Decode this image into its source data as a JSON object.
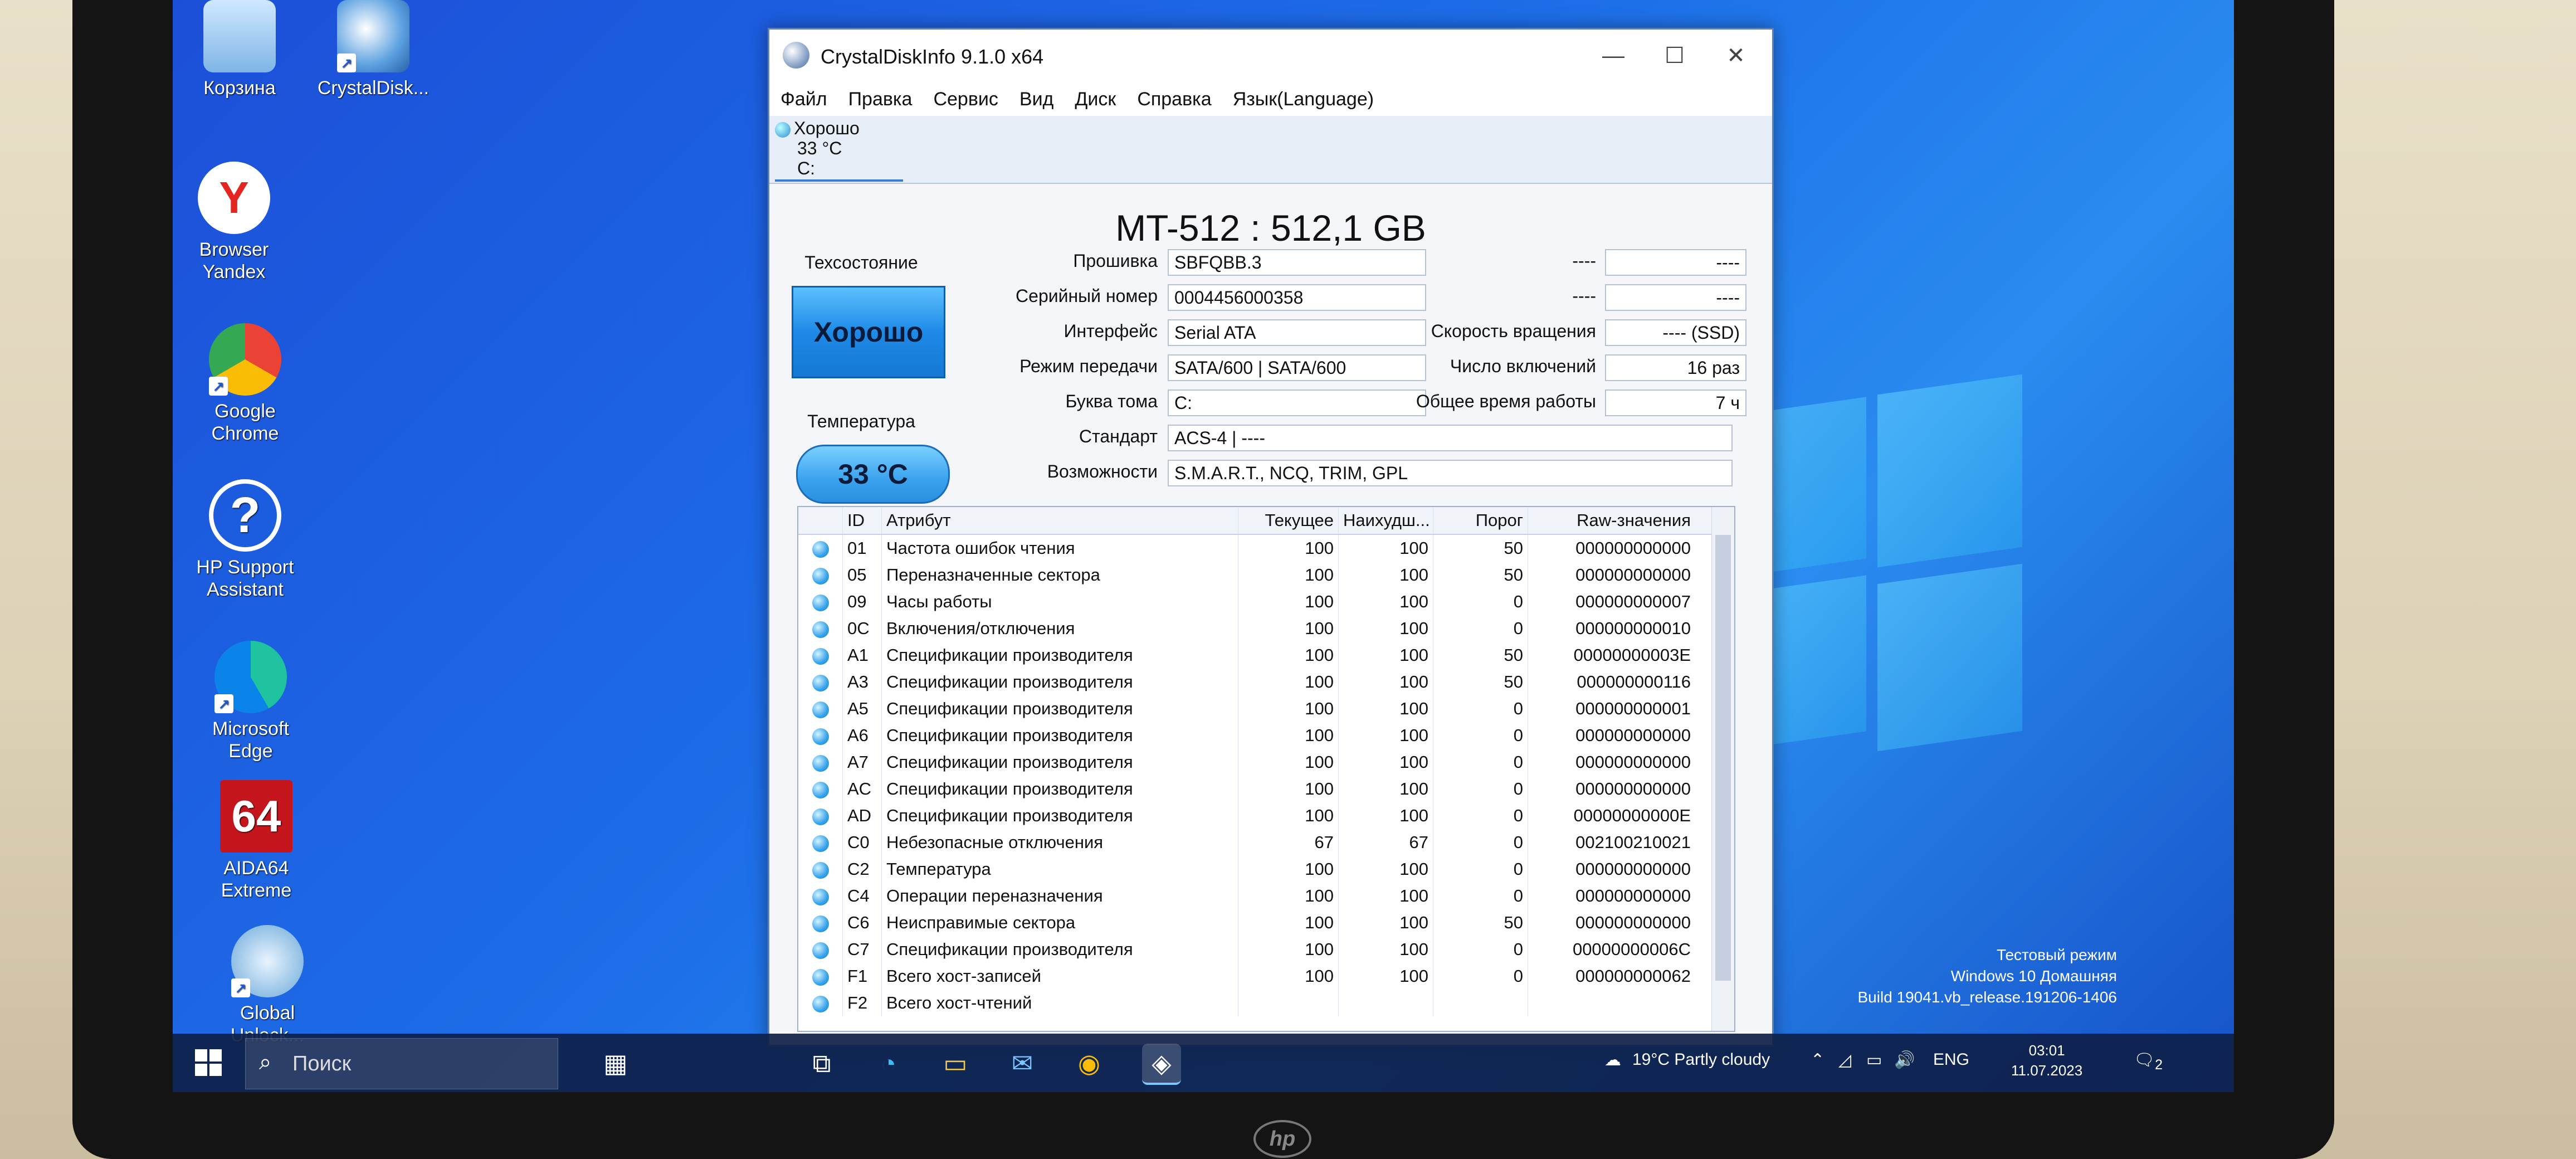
{
  "desktop": {
    "icons": [
      {
        "label": "Корзина",
        "icon": "recycle-bin-icon"
      },
      {
        "label": "CrystalDisk...",
        "icon": "crystaldisk-icon"
      },
      {
        "label": "Browser Yandex",
        "icon": "yandex-browser-icon"
      },
      {
        "label": "Google Chrome",
        "icon": "chrome-icon"
      },
      {
        "label": "HP Support Assistant",
        "icon": "help-icon"
      },
      {
        "label": "Microsoft Edge",
        "icon": "edge-icon"
      },
      {
        "label": "AIDA64 Extreme",
        "icon": "aida64-icon"
      },
      {
        "label": "Global Unlock...",
        "icon": "unlock-icon"
      }
    ]
  },
  "window": {
    "title": "CrystalDiskInfo 9.1.0 x64",
    "menu": [
      "Файл",
      "Правка",
      "Сервис",
      "Вид",
      "Диск",
      "Справка",
      "Язык(Language)"
    ],
    "drive_tab": {
      "status": "Хорошо",
      "temp": "33 °C",
      "letter": "C:"
    },
    "model": "MT-512 : 512,1 GB",
    "health_label": "Техсостояние",
    "health_value": "Хорошо",
    "temp_label": "Температура",
    "temp_value": "33 °C",
    "info": {
      "firmware": {
        "label": "Прошивка",
        "value": "SBFQBB.3"
      },
      "serial": {
        "label": "Серийный номер",
        "value": "0004456000358"
      },
      "interface": {
        "label": "Интерфейс",
        "value": "Serial ATA"
      },
      "transfer": {
        "label": "Режим передачи",
        "value": "SATA/600 | SATA/600"
      },
      "volume": {
        "label": "Буква тома",
        "value": "C:"
      },
      "standard": {
        "label": "Стандарт",
        "value": "ACS-4 | ----"
      },
      "features": {
        "label": "Возможности",
        "value": "S.M.A.R.T., NCQ, TRIM, GPL"
      }
    },
    "right_info": {
      "row1": {
        "label": "----",
        "value": "----"
      },
      "row2": {
        "label": "----",
        "value": "----"
      },
      "rotation": {
        "label": "Скорость вращения",
        "value": "---- (SSD)"
      },
      "power_count": {
        "label": "Число включений",
        "value": "16 раз"
      },
      "power_hours": {
        "label": "Общее время работы",
        "value": "7 ч"
      }
    },
    "smart_headers": {
      "id": "ID",
      "attr": "Атрибут",
      "current": "Текущее",
      "worst": "Наихудш...",
      "threshold": "Порог",
      "raw": "Raw-значения"
    },
    "smart_rows": [
      {
        "id": "01",
        "attr": "Частота ошибок чтения",
        "current": "100",
        "worst": "100",
        "threshold": "50",
        "raw": "000000000000"
      },
      {
        "id": "05",
        "attr": "Переназначенные сектора",
        "current": "100",
        "worst": "100",
        "threshold": "50",
        "raw": "000000000000"
      },
      {
        "id": "09",
        "attr": "Часы работы",
        "current": "100",
        "worst": "100",
        "threshold": "0",
        "raw": "000000000007"
      },
      {
        "id": "0C",
        "attr": "Включения/отключения",
        "current": "100",
        "worst": "100",
        "threshold": "0",
        "raw": "000000000010"
      },
      {
        "id": "A1",
        "attr": "Спецификации производителя",
        "current": "100",
        "worst": "100",
        "threshold": "50",
        "raw": "00000000003E"
      },
      {
        "id": "A3",
        "attr": "Спецификации производителя",
        "current": "100",
        "worst": "100",
        "threshold": "50",
        "raw": "000000000116"
      },
      {
        "id": "A5",
        "attr": "Спецификации производителя",
        "current": "100",
        "worst": "100",
        "threshold": "0",
        "raw": "000000000001"
      },
      {
        "id": "A6",
        "attr": "Спецификации производителя",
        "current": "100",
        "worst": "100",
        "threshold": "0",
        "raw": "000000000000"
      },
      {
        "id": "A7",
        "attr": "Спецификации производителя",
        "current": "100",
        "worst": "100",
        "threshold": "0",
        "raw": "000000000000"
      },
      {
        "id": "AC",
        "attr": "Спецификации производителя",
        "current": "100",
        "worst": "100",
        "threshold": "0",
        "raw": "000000000000"
      },
      {
        "id": "AD",
        "attr": "Спецификации производителя",
        "current": "100",
        "worst": "100",
        "threshold": "0",
        "raw": "00000000000E"
      },
      {
        "id": "C0",
        "attr": "Небезопасные отключения",
        "current": "67",
        "worst": "67",
        "threshold": "0",
        "raw": "002100210021"
      },
      {
        "id": "C2",
        "attr": "Температура",
        "current": "100",
        "worst": "100",
        "threshold": "0",
        "raw": "000000000000"
      },
      {
        "id": "C4",
        "attr": "Операции переназначения",
        "current": "100",
        "worst": "100",
        "threshold": "0",
        "raw": "000000000000"
      },
      {
        "id": "C6",
        "attr": "Неисправимые сектора",
        "current": "100",
        "worst": "100",
        "threshold": "50",
        "raw": "000000000000"
      },
      {
        "id": "C7",
        "attr": "Спецификации производителя",
        "current": "100",
        "worst": "100",
        "threshold": "0",
        "raw": "00000000006C"
      },
      {
        "id": "F1",
        "attr": "Всего хост-записей",
        "current": "100",
        "worst": "100",
        "threshold": "0",
        "raw": "000000000062"
      },
      {
        "id": "F2",
        "attr": "Всего хост-чтений",
        "current": "",
        "worst": "",
        "threshold": "",
        "raw": ""
      }
    ]
  },
  "watermark": {
    "line1": "Тестовый режим",
    "line2": "Windows 10 Домашняя",
    "line3": "Build 19041.vb_release.191206-1406"
  },
  "taskbar": {
    "search_placeholder": "Поиск",
    "weather": "19°C  Partly cloudy",
    "lang": "ENG",
    "time": "03:01",
    "date": "11.07.2023",
    "notifications": "2"
  },
  "colors": {
    "desktop_blue": "#1d6ee8",
    "health_blue": "#1e8ae6",
    "taskbar": "#0e2048"
  }
}
